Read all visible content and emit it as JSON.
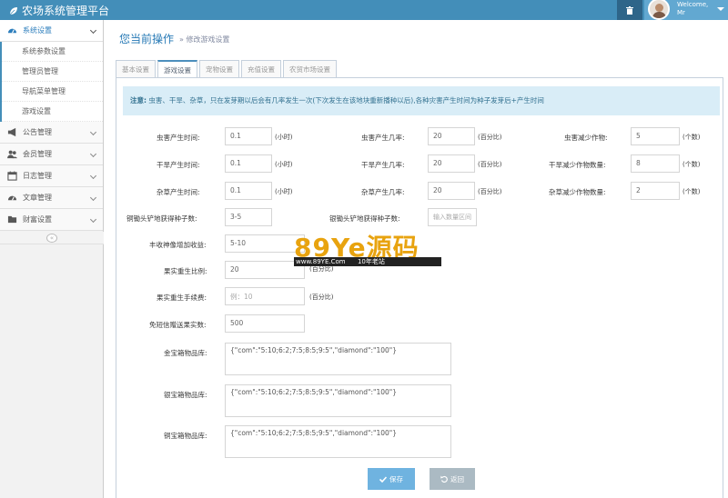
{
  "header": {
    "title": "农场系统管理平台",
    "welcome": "Welcome,",
    "user": "Mr"
  },
  "sidebar": {
    "items": [
      {
        "label": "系统设置",
        "icon": "dashboard-icon",
        "active": true
      },
      {
        "label": "公告管理",
        "icon": "megaphone-icon"
      },
      {
        "label": "会员管理",
        "icon": "users-icon"
      },
      {
        "label": "日志管理",
        "icon": "calendar-icon"
      },
      {
        "label": "文章管理",
        "icon": "dashboard-icon"
      },
      {
        "label": "财富设置",
        "icon": "folder-icon"
      }
    ],
    "subitems": [
      "系统参数设置",
      "管理员管理",
      "导航菜单管理",
      "游戏设置"
    ],
    "collapse": "«"
  },
  "breadcrumb": {
    "title": "您当前操作",
    "sub": "» 修改游戏设置"
  },
  "tabs": [
    "基本设置",
    "游戏设置",
    "宠物设置",
    "充值设置",
    "农贸市场设置"
  ],
  "notice": {
    "prefix": "注意:",
    "text": " 虫害、干旱、杂草，只在发芽期以后会有几率发生一次(下次发生在该地块重新播种以后),各种灾害产生时间为种子发芽后+产生时间"
  },
  "form": {
    "row1": {
      "a_label": "虫害产生时间:",
      "a_value": "0.1",
      "a_unit": "(小时)",
      "b_label": "虫害产生几率:",
      "b_value": "20",
      "b_unit": "(百分比)",
      "c_label": "虫害减少作物:",
      "c_value": "5",
      "c_unit": "(个数)"
    },
    "row2": {
      "a_label": "干旱产生时间:",
      "a_value": "0.1",
      "a_unit": "(小时)",
      "b_label": "干旱产生几率:",
      "b_value": "20",
      "b_unit": "(百分比)",
      "c_label": "干旱减少作物数量:",
      "c_value": "8",
      "c_unit": "(个数)"
    },
    "row3": {
      "a_label": "杂草产生时间:",
      "a_value": "0.1",
      "a_unit": "(小时)",
      "b_label": "杂草产生几率:",
      "b_value": "20",
      "b_unit": "(百分比)",
      "c_label": "杂草减少作物数量:",
      "c_value": "2",
      "c_unit": "(个数)"
    },
    "seeds": {
      "label1": "铜锄头铲地获得种子数:",
      "value1": "3-5",
      "label2": "银锄头铲地获得种子数:",
      "placeholder2": "输入数量区间"
    },
    "harvest_label": "丰收神像增加收益:",
    "harvest_value": "5-10",
    "regrow_label": "果实重生比例:",
    "regrow_value": "20",
    "regrow_unit": "(百分比)",
    "regrow_fee_label": "果实重生手续费:",
    "regrow_fee_placeholder": "例：10",
    "regrow_fee_unit": "(百分比)",
    "sms_label": "免短信赠送果实数:",
    "sms_value": "500",
    "gold_label": "金宝箱物品库:",
    "gold_value": "{\"com\":\"5:10;6:2;7:5;8:5;9:5\",\"diamond\":\"100\"}",
    "silver_label": "银宝箱物品库:",
    "silver_value": "{\"com\":\"5:10;6:2;7:5;8:5;9:5\",\"diamond\":\"100\"}",
    "copper_label": "铜宝箱物品库:",
    "copper_value": "{\"com\":\"5:10;6:2;7:5;8:5;9:5\",\"diamond\":\"100\"}"
  },
  "buttons": {
    "save": "保存",
    "back": "返回"
  },
  "watermark": {
    "logo": "89Ye源码",
    "site": "www.89YE.Com",
    "tagline": "10年老站"
  },
  "colors": {
    "topbar": "#438eb9",
    "accent": "#2679b5",
    "notice_bg": "#d9edf7"
  }
}
